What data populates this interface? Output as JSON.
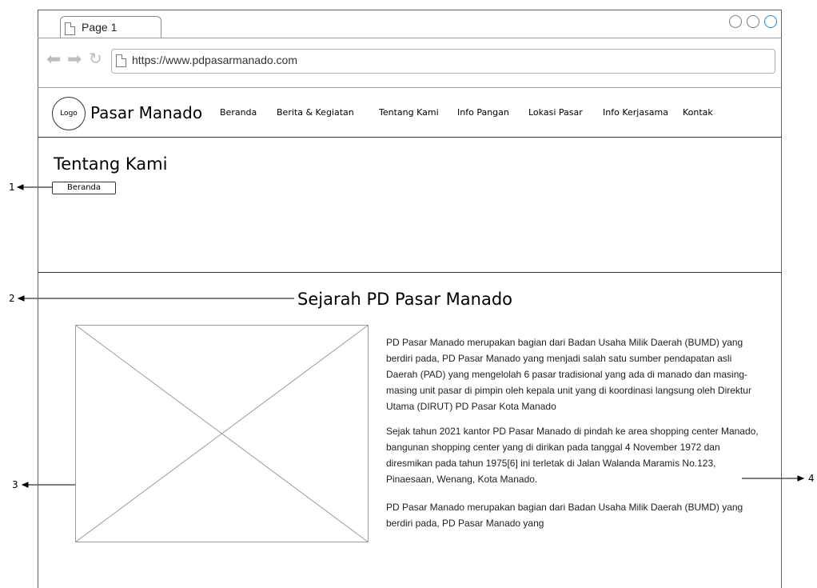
{
  "browser": {
    "tab_title": "Page 1",
    "url": "https://www.pdpasarmanado.com",
    "window_controls": [
      "circle-icon",
      "circle-icon",
      "circle-icon"
    ]
  },
  "header": {
    "logo_text": "Logo",
    "brand": "Pasar Manado",
    "nav": [
      "Beranda",
      "Berita & Kegiatan",
      "Tentang Kami",
      "Info Pangan",
      "Lokasi Pasar",
      "Info Kerjasama",
      "Kontak"
    ]
  },
  "hero": {
    "title": "Tentang Kami",
    "breadcrumb": "Beranda"
  },
  "section": {
    "title": "Sejarah PD Pasar Manado",
    "image_icon": "image-placeholder-icon",
    "paragraphs": [
      "PD Pasar Manado merupakan bagian dari Badan Usaha Milik Daerah (BUMD) yang berdiri pada, PD Pasar Manado yang menjadi salah satu sumber pendapatan asli Daerah (PAD) yang mengelolah 6 pasar tradisional yang ada di manado dan masing-masing unit pasar di pimpin oleh kepala unit yang di koordinasi langsung oleh Direktur Utama (DIRUT) PD Pasar Kota Manado",
      "Sejak tahun 2021 kantor PD Pasar Manado di pindah ke area shopping center Manado, bangunan shopping center yang di dirikan pada tanggal 4 November 1972 dan diresmikan pada tahun 1975[6] ini terletak di Jalan Walanda Maramis No.123, Pinaesaan, Wenang, Kota Manado.",
      "PD Pasar Manado merupakan bagian dari Badan Usaha Milik Daerah (BUMD) yang berdiri pada, PD Pasar Manado yang"
    ]
  },
  "annotations": {
    "m1": "1",
    "m2": "2",
    "m3": "3",
    "m4": "4"
  }
}
